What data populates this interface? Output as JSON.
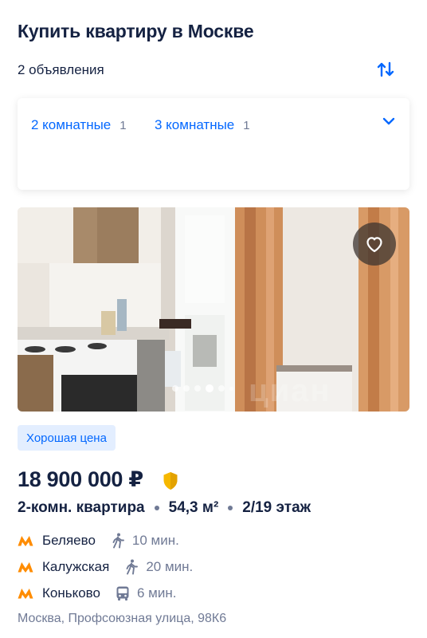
{
  "header": {
    "title": "Купить квартиру в Москве",
    "count": "2 объявления"
  },
  "filters": {
    "chips": [
      {
        "label": "2 комнатные",
        "count": "1"
      },
      {
        "label": "3 комнатные",
        "count": "1"
      }
    ]
  },
  "listing": {
    "badge": "Хорошая цена",
    "price": "18 900 000 ₽",
    "params": {
      "type": "2-комн. квартира",
      "area": "54,3 м²",
      "floor": "2/19 этаж"
    },
    "metro": [
      {
        "name": "Беляево",
        "time": "10 мин.",
        "mode": "walk-icon"
      },
      {
        "name": "Калужская",
        "time": "20 мин.",
        "mode": "walk-icon"
      },
      {
        "name": "Коньково",
        "time": "6 мин.",
        "mode": "bus-icon"
      }
    ],
    "address": "Москва, Профсоюзная улица, 98К6",
    "photo": {
      "watermark": "циан",
      "slide_index": 3,
      "slide_count": 6
    }
  },
  "colors": {
    "accent": "#0468ff",
    "metro": "#ff8c00",
    "text": "#152242",
    "muted": "#707a95"
  }
}
